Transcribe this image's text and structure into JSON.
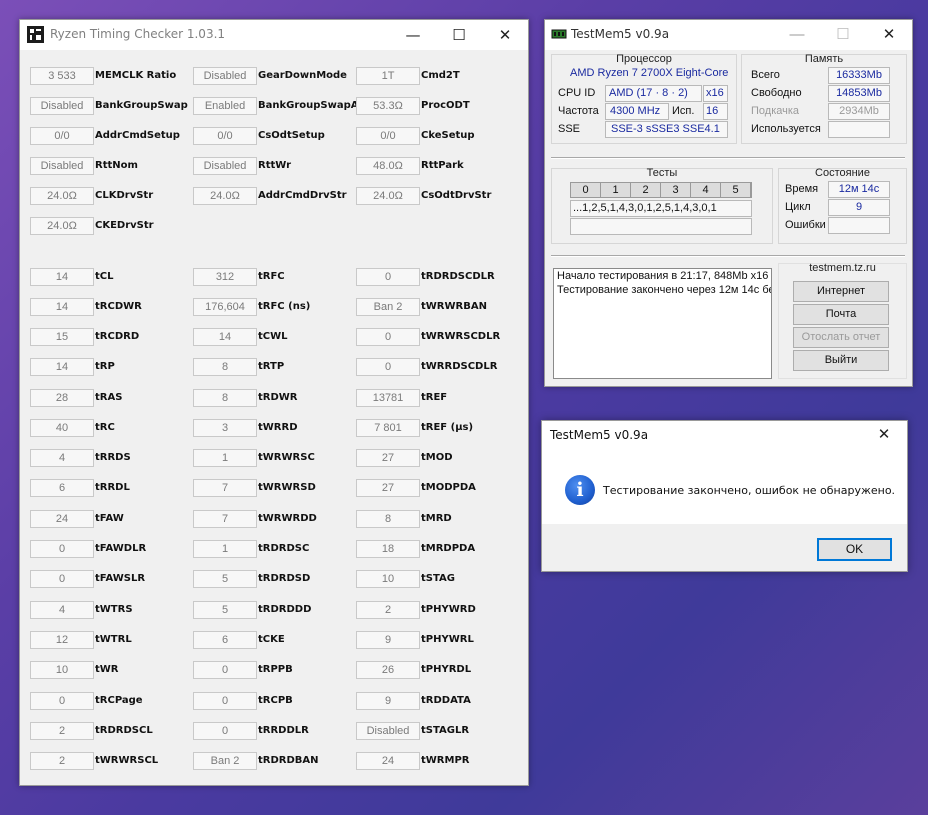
{
  "rtc": {
    "title": "Ryzen Timing Checker 1.03.1",
    "window_controls": {
      "minimize": "—",
      "maximize": "☐",
      "close": "✕"
    },
    "rows": [
      [
        {
          "v": "3 533",
          "l": "MEMCLK Ratio"
        },
        {
          "v": "Disabled",
          "l": "GearDownMode"
        },
        {
          "v": "1T",
          "l": "Cmd2T"
        }
      ],
      [
        {
          "v": "Disabled",
          "l": "BankGroupSwap"
        },
        {
          "v": "Enabled",
          "l": "BankGroupSwapAlt"
        },
        {
          "v": "53.3Ω",
          "l": "ProcODT"
        }
      ],
      [
        {
          "v": "0/0",
          "l": "AddrCmdSetup"
        },
        {
          "v": "0/0",
          "l": "CsOdtSetup"
        },
        {
          "v": "0/0",
          "l": "CkeSetup"
        }
      ],
      [
        {
          "v": "Disabled",
          "l": "RttNom"
        },
        {
          "v": "Disabled",
          "l": "RttWr"
        },
        {
          "v": "48.0Ω",
          "l": "RttPark"
        }
      ],
      [
        {
          "v": "24.0Ω",
          "l": "CLKDrvStr"
        },
        {
          "v": "24.0Ω",
          "l": "AddrCmdDrvStr"
        },
        {
          "v": "24.0Ω",
          "l": "CsOdtDrvStr"
        }
      ],
      [
        {
          "v": "24.0Ω",
          "l": "CKEDrvStr"
        }
      ],
      [
        {
          "v": "14",
          "l": "tCL"
        },
        {
          "v": "312",
          "l": "tRFC"
        },
        {
          "v": "0",
          "l": "tRDRDSCDLR"
        }
      ],
      [
        {
          "v": "14",
          "l": "tRCDWR"
        },
        {
          "v": "176,604",
          "l": "tRFC (ns)"
        },
        {
          "v": "Ban 2",
          "l": "tWRWRBAN"
        }
      ],
      [
        {
          "v": "15",
          "l": "tRCDRD"
        },
        {
          "v": "14",
          "l": "tCWL"
        },
        {
          "v": "0",
          "l": "tWRWRSCDLR"
        }
      ],
      [
        {
          "v": "14",
          "l": "tRP"
        },
        {
          "v": "8",
          "l": "tRTP"
        },
        {
          "v": "0",
          "l": "tWRRDSCDLR"
        }
      ],
      [
        {
          "v": "28",
          "l": "tRAS"
        },
        {
          "v": "8",
          "l": "tRDWR"
        },
        {
          "v": "13781",
          "l": "tREF"
        }
      ],
      [
        {
          "v": "40",
          "l": "tRC"
        },
        {
          "v": "3",
          "l": "tWRRD"
        },
        {
          "v": "7 801",
          "l": "tREF (µs)"
        }
      ],
      [
        {
          "v": "4",
          "l": "tRRDS"
        },
        {
          "v": "1",
          "l": "tWRWRSC"
        },
        {
          "v": "27",
          "l": "tMOD"
        }
      ],
      [
        {
          "v": "6",
          "l": "tRRDL"
        },
        {
          "v": "7",
          "l": "tWRWRSD"
        },
        {
          "v": "27",
          "l": "tMODPDA"
        }
      ],
      [
        {
          "v": "24",
          "l": "tFAW"
        },
        {
          "v": "7",
          "l": "tWRWRDD"
        },
        {
          "v": "8",
          "l": "tMRD"
        }
      ],
      [
        {
          "v": "0",
          "l": "tFAWDLR"
        },
        {
          "v": "1",
          "l": "tRDRDSC"
        },
        {
          "v": "18",
          "l": "tMRDPDA"
        }
      ],
      [
        {
          "v": "0",
          "l": "tFAWSLR"
        },
        {
          "v": "5",
          "l": "tRDRDSD"
        },
        {
          "v": "10",
          "l": "tSTAG"
        }
      ],
      [
        {
          "v": "4",
          "l": "tWTRS"
        },
        {
          "v": "5",
          "l": "tRDRDDD"
        },
        {
          "v": "2",
          "l": "tPHYWRD"
        }
      ],
      [
        {
          "v": "12",
          "l": "tWTRL"
        },
        {
          "v": "6",
          "l": "tCKE"
        },
        {
          "v": "9",
          "l": "tPHYWRL"
        }
      ],
      [
        {
          "v": "10",
          "l": "tWR"
        },
        {
          "v": "0",
          "l": "tRPPB"
        },
        {
          "v": "26",
          "l": "tPHYRDL"
        }
      ],
      [
        {
          "v": "0",
          "l": "tRCPage"
        },
        {
          "v": "0",
          "l": "tRCPB"
        },
        {
          "v": "9",
          "l": "tRDDATA"
        }
      ],
      [
        {
          "v": "2",
          "l": "tRDRDSCL"
        },
        {
          "v": "0",
          "l": "tRRDDLR"
        },
        {
          "v": "Disabled",
          "l": "tSTAGLR"
        }
      ],
      [
        {
          "v": "2",
          "l": "tWRWRSCL"
        },
        {
          "v": "Ban 2",
          "l": "tRDRDBAN"
        },
        {
          "v": "24",
          "l": "tWRMPR"
        }
      ]
    ]
  },
  "testmem": {
    "title": "TestMem5 v0.9a",
    "window_controls": {
      "minimize": "—",
      "maximize": "☐",
      "close": "✕"
    },
    "processor": {
      "group_title": "Процессор",
      "name": "AMD Ryzen 7 2700X Eight-Core",
      "cpuid_label": "CPU ID",
      "cpuid_value": "AMD  (17 · 8 · 2)",
      "cpuid_x": "x16",
      "freq_label": "Частота",
      "freq_value": "4300 MHz",
      "used_label": "Исп.",
      "used_value": "16",
      "sse_label": "SSE",
      "sse_value": "SSE-3 sSSE3 SSE4.1"
    },
    "memory": {
      "group_title": "Память",
      "total_label": "Всего",
      "total_value": "16333Mb",
      "free_label": "Свободно",
      "free_value": "14853Mb",
      "swap_label": "Подкачка",
      "swap_value": "2934Mb",
      "used_label": "Используется",
      "used_value": ""
    },
    "tests": {
      "group_title": "Тесты",
      "numbers": [
        "0",
        "1",
        "2",
        "3",
        "4",
        "5"
      ],
      "sequence": "...1,2,5,1,4,3,0,1,2,5,1,4,3,0,1"
    },
    "state": {
      "group_title": "Состояние",
      "time_label": "Время",
      "time_value": "12м 14с",
      "cycle_label": "Цикл",
      "cycle_value": "9",
      "errors_label": "Ошибки",
      "errors_value": ""
    },
    "log": [
      "Начало тестирования в 21:17, 848Mb x16",
      "Тестирование закончено через 12м 14с бе"
    ],
    "site": "testmem.tz.ru",
    "buttons": {
      "internet": "Интернет",
      "mail": "Почта",
      "send_report": "Отослать отчет",
      "exit": "Выйти"
    }
  },
  "dialog": {
    "title": "TestMem5 v0.9a",
    "close": "✕",
    "icon_glyph": "i",
    "message": "Тестирование закончено, ошибок не обнаружено.",
    "ok_label": "OK"
  },
  "colors": {
    "desktop_accent": "#5a3ea6",
    "value_text": "#1a2aa0",
    "focus_border": "#0078d7",
    "info_icon": "#1f5fcf"
  }
}
